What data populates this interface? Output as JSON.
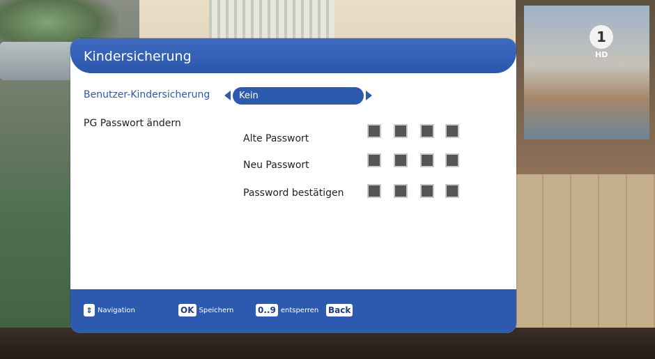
{
  "channel": {
    "logo_text": "1",
    "hd_label": "HD"
  },
  "dialog": {
    "title": "Kindersicherung",
    "user_lock": {
      "label": "Benutzer-Kindersicherung",
      "value": "Kein"
    },
    "pg_change_label": "PG Passwort ändern",
    "password_fields": [
      {
        "label": "Alte Passwort"
      },
      {
        "label": "Neu Passwort"
      },
      {
        "label": "Password bestätigen"
      }
    ]
  },
  "footer": {
    "navigation": {
      "key_icon": "up-down-icon",
      "label": "Navigation"
    },
    "save": {
      "key": "OK",
      "label": "Speichern"
    },
    "unlock": {
      "key": "0..9",
      "label": "entsperren"
    },
    "back": {
      "key": "Back"
    }
  },
  "colors": {
    "accent": "#2d5aae",
    "panel": "#ffffff",
    "pin_box": "#555555"
  }
}
